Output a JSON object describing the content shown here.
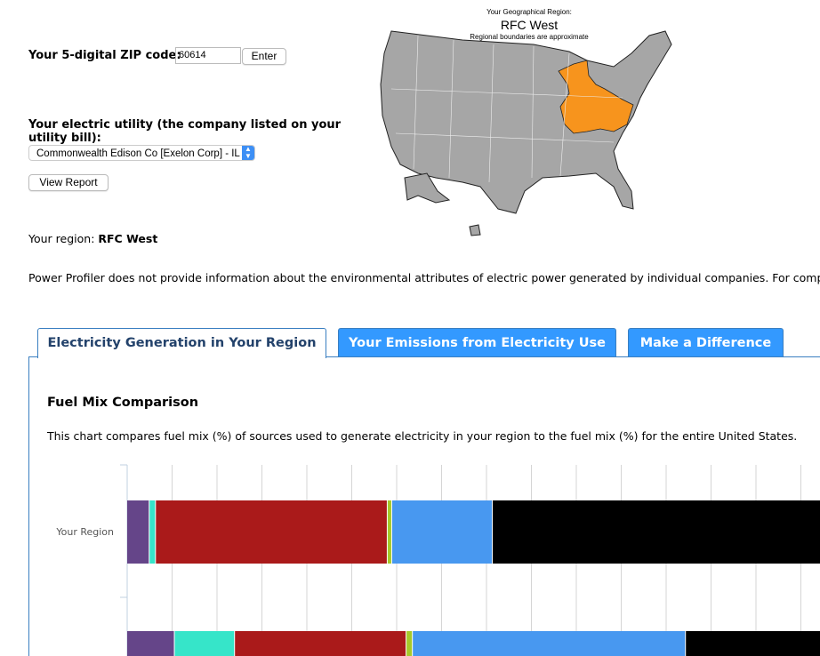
{
  "form": {
    "zip_label": "Your 5-digital ZIP code:",
    "zip_value": "60614",
    "enter_label": "Enter",
    "utility_label": "Your electric utility (the company listed on your utility bill):",
    "utility_selected": "Commonwealth Edison Co [Exelon Corp] - IL",
    "view_report_label": "View Report"
  },
  "region": {
    "prefix": "Your region:",
    "name": "RFC West"
  },
  "note": "Power Profiler does not provide information about the environmental attributes of electric power generated by individual companies. For company-s",
  "map": {
    "caption": "Your Geographical Region:",
    "region_name": "RFC West",
    "disclaimer": "Regional boundaries are approximate",
    "highlight_color": "#f7941d",
    "base_color": "#a6a6a6"
  },
  "tabs": [
    {
      "label": "Electricity Generation in Your Region",
      "active": true
    },
    {
      "label": "Your Emissions from Electricity Use",
      "active": false
    },
    {
      "label": "Make a Difference",
      "active": false
    }
  ],
  "section": {
    "title": "Fuel Mix Comparison",
    "description": "This chart compares fuel mix (%) of sources used to generate electricity in your region to the fuel mix (%) for the entire United States."
  },
  "chart_data": {
    "type": "bar",
    "stacked": true,
    "orientation": "horizontal",
    "categories": [
      "Your Region",
      ""
    ],
    "grid": true,
    "segment_colors": [
      "#654589",
      "#36e5c9",
      "#aa1a1a",
      "#a6c92a",
      "#4898f0",
      "#000000"
    ],
    "series_values": [
      [
        2.5,
        0.7,
        25.8,
        0.5,
        11.2,
        59.3
      ],
      [
        5.3,
        6.7,
        19.1,
        0.7,
        30.4,
        37.8
      ]
    ]
  }
}
